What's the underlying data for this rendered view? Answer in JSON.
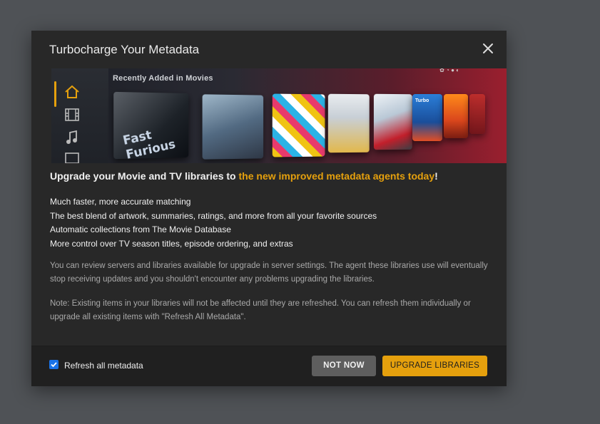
{
  "modal": {
    "title": "Turbocharge Your Metadata",
    "banner": {
      "heading": "Recently Added in Movies",
      "poster_captions": [
        "Fast Furious",
        "Turbo"
      ]
    },
    "headline_prefix": "Upgrade your Movie and TV libraries to ",
    "headline_link": "the new improved metadata agents today",
    "headline_suffix": "!",
    "features": [
      "Much faster, more accurate matching",
      "The best blend of artwork, summaries, ratings, and more from all your favorite sources",
      "Automatic collections from The Movie Database",
      "More control over TV season titles, episode ordering, and extras"
    ],
    "paragraph1": "You can review servers and libraries available for upgrade in server settings. The agent these libraries use will eventually stop receiving updates and you shouldn't encounter any problems upgrading the libraries.",
    "paragraph2": "Note: Existing items in your libraries will not be affected until they are refreshed. You can refresh them individually or upgrade all existing items with \"Refresh All Metadata\".",
    "footer": {
      "checkbox_label": "Refresh all metadata",
      "checkbox_checked": true,
      "not_now_label": "NOT NOW",
      "upgrade_label": "UPGRADE LIBRARIES"
    }
  },
  "colors": {
    "accent": "#e5a00d",
    "modal_bg": "#282828",
    "backdrop": "#4f5256",
    "checkbox": "#1a73e8"
  },
  "icons": [
    "close-icon",
    "home-icon",
    "film-icon",
    "music-icon",
    "tv-icon",
    "check-icon"
  ]
}
